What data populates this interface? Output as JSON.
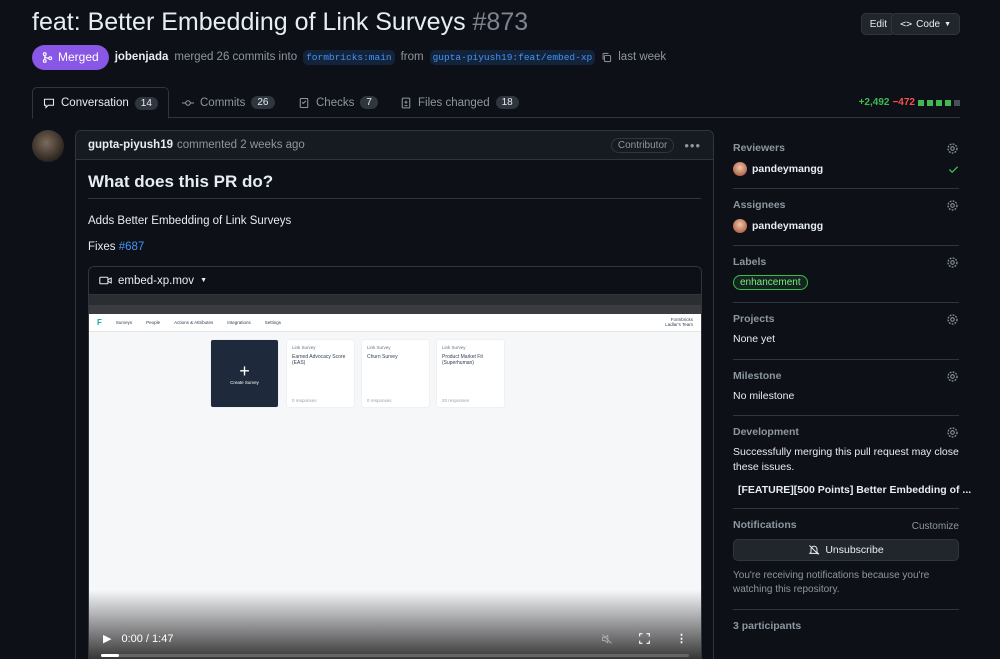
{
  "pr": {
    "title": "feat: Better Embedding of Link Surveys",
    "number": "#873",
    "edit_label": "Edit",
    "code_label": "Code",
    "state": "Merged",
    "author": "jobenjada",
    "merge_text": "merged 26 commits into",
    "base_branch": "formbricks:main",
    "from_text": "from",
    "head_branch": "gupta-piyush19:feat/embed-xp",
    "time": "last week"
  },
  "tabs": [
    {
      "label": "Conversation",
      "count": "14",
      "icon": "comment-icon"
    },
    {
      "label": "Commits",
      "count": "26",
      "icon": "commit-icon"
    },
    {
      "label": "Checks",
      "count": "7",
      "icon": "checks-icon"
    },
    {
      "label": "Files changed",
      "count": "18",
      "icon": "file-diff-icon"
    }
  ],
  "diffstat": {
    "additions": "+2,492",
    "deletions": "−472",
    "green": "#3fb950",
    "red": "#f85149"
  },
  "comment": {
    "author": "gupta-piyush19",
    "meta": "commented 2 weeks ago",
    "role": "Contributor",
    "heading": "What does this PR do?",
    "description": "Adds Better Embedding of Link Surveys",
    "fixes_label": "Fixes",
    "fixes_link": "#687",
    "video": {
      "filename": "embed-xp.mov",
      "time": "0:00 / 1:47",
      "progress": 0.03,
      "nav": [
        "Surveys",
        "People",
        "Actions & Attributes",
        "Integrations",
        "Settings"
      ],
      "brand": "Formbricks",
      "team": "Ladlar's Team",
      "create_label": "Create Survey",
      "cards": [
        {
          "tag": "Link Survey",
          "name": "Earned Advocacy Score (EAS)",
          "responses": "0 responses"
        },
        {
          "tag": "Link Survey",
          "name": "Churn Survey",
          "responses": "0 responses"
        },
        {
          "tag": "Link Survey",
          "name": "Product Market Fit (Superhuman)",
          "responses": "20 responses"
        }
      ]
    }
  },
  "sidebar": {
    "reviewers": {
      "title": "Reviewers",
      "user": "pandeymangg"
    },
    "assignees": {
      "title": "Assignees",
      "user": "pandeymangg"
    },
    "labels": {
      "title": "Labels",
      "label": "enhancement"
    },
    "projects": {
      "title": "Projects",
      "value": "None yet"
    },
    "milestone": {
      "title": "Milestone",
      "value": "No milestone"
    },
    "development": {
      "title": "Development",
      "text": "Successfully merging this pull request may close these issues.",
      "issue": "[FEATURE][500 Points] Better Embedding of ..."
    },
    "notifications": {
      "title": "Notifications",
      "customize": "Customize",
      "unsubscribe": "Unsubscribe",
      "text": "You're receiving notifications because you're watching this repository."
    },
    "participants": "3 participants"
  }
}
